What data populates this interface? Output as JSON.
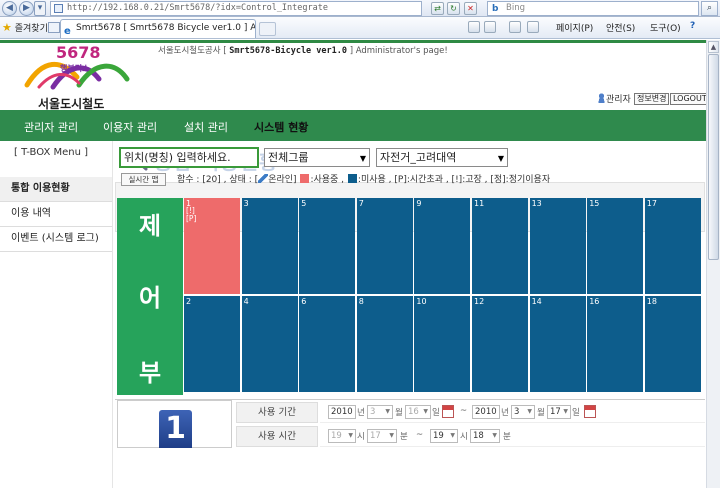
{
  "browser": {
    "url": "http://192.168.0.21/Smrt5678/?idx=Control_Integrate",
    "search_placeholder": "Bing",
    "favorites_label": "즐겨찾기",
    "tab_title": "Smrt5678 [ Smrt5678 Bicycle ver1.0 ] Adminis...",
    "page_menu": "페이지(P)",
    "safety_menu": "안전(S)",
    "tools_menu": "도구(O)",
    "help_icon": "?"
  },
  "header": {
    "logo_number": "5678",
    "logo_tag": "행복미소",
    "logo_org": "서울도시철도",
    "admin_prefix": "서울도시철도공사 [",
    "admin_system": "Smrt5678-Bicycle ver1.0",
    "admin_suffix": "] Administrator's page!",
    "admin_label": "관리자",
    "profile_button": "정보변경",
    "logout_button": "LOGOUT"
  },
  "menu": {
    "items": [
      "관리자 관리",
      "이용자 관리",
      "설치 관리",
      "시스템 현황"
    ],
    "active_index": 3
  },
  "sidebar": {
    "heading": "[ T-BOX Menu ]",
    "items": [
      "통합 이용현황",
      "이용 내역",
      "이벤트 (시스템 로그)"
    ],
    "active_index": 0
  },
  "main": {
    "title": "통합 이용현황",
    "location_input": "위치(명칭) 입력하세요.",
    "group_select": "전체그룹",
    "station_select": "자전거_고려대역",
    "realtime_button": "실시간 맵",
    "legend": {
      "count_text": "함수 : [20] , 상태 : [",
      "online": "온라인]",
      "in_use": ":사용중 ,",
      "not_used": ":미사용 , [P]:시간초과 , [!]:고장 , [정]:정기이용자",
      "in_use_color": "#ee6b6b",
      "not_used_color": "#0d5d8c"
    },
    "board_label": [
      "제",
      "어",
      "부"
    ],
    "board_color": "#26a35b",
    "bays_top": [
      {
        "no": "1",
        "status": "in_use",
        "flags": [
          "[!]",
          "[P]"
        ]
      },
      {
        "no": "3",
        "status": "not_used",
        "flags": []
      },
      {
        "no": "5",
        "status": "not_used",
        "flags": []
      },
      {
        "no": "7",
        "status": "not_used",
        "flags": []
      },
      {
        "no": "9",
        "status": "not_used",
        "flags": []
      },
      {
        "no": "11",
        "status": "not_used",
        "flags": []
      },
      {
        "no": "13",
        "status": "not_used",
        "flags": []
      },
      {
        "no": "15",
        "status": "not_used",
        "flags": []
      },
      {
        "no": "17",
        "status": "not_used",
        "flags": []
      }
    ],
    "bays_bottom": [
      {
        "no": "2",
        "status": "not_used",
        "flags": []
      },
      {
        "no": "4",
        "status": "not_used",
        "flags": []
      },
      {
        "no": "6",
        "status": "not_used",
        "flags": []
      },
      {
        "no": "8",
        "status": "not_used",
        "flags": []
      },
      {
        "no": "10",
        "status": "not_used",
        "flags": []
      },
      {
        "no": "12",
        "status": "not_used",
        "flags": []
      },
      {
        "no": "14",
        "status": "not_used",
        "flags": []
      },
      {
        "no": "16",
        "status": "not_used",
        "flags": []
      },
      {
        "no": "18",
        "status": "not_used",
        "flags": []
      }
    ],
    "selected_bay_number": "1",
    "period_label": "사용 기간",
    "time_label": "사용 시간",
    "period": {
      "from_year": "2010",
      "from_month": "3",
      "from_day": "16",
      "to_year": "2010",
      "to_month": "3",
      "to_day": "17",
      "year_unit": "년",
      "month_unit": "월",
      "day_unit": "일",
      "tilde": "~"
    },
    "time": {
      "from_hour": "19",
      "from_min": "17",
      "to_hour": "19",
      "to_min": "18",
      "hour_unit": "시",
      "min_unit": "분",
      "tilde": "~"
    }
  }
}
